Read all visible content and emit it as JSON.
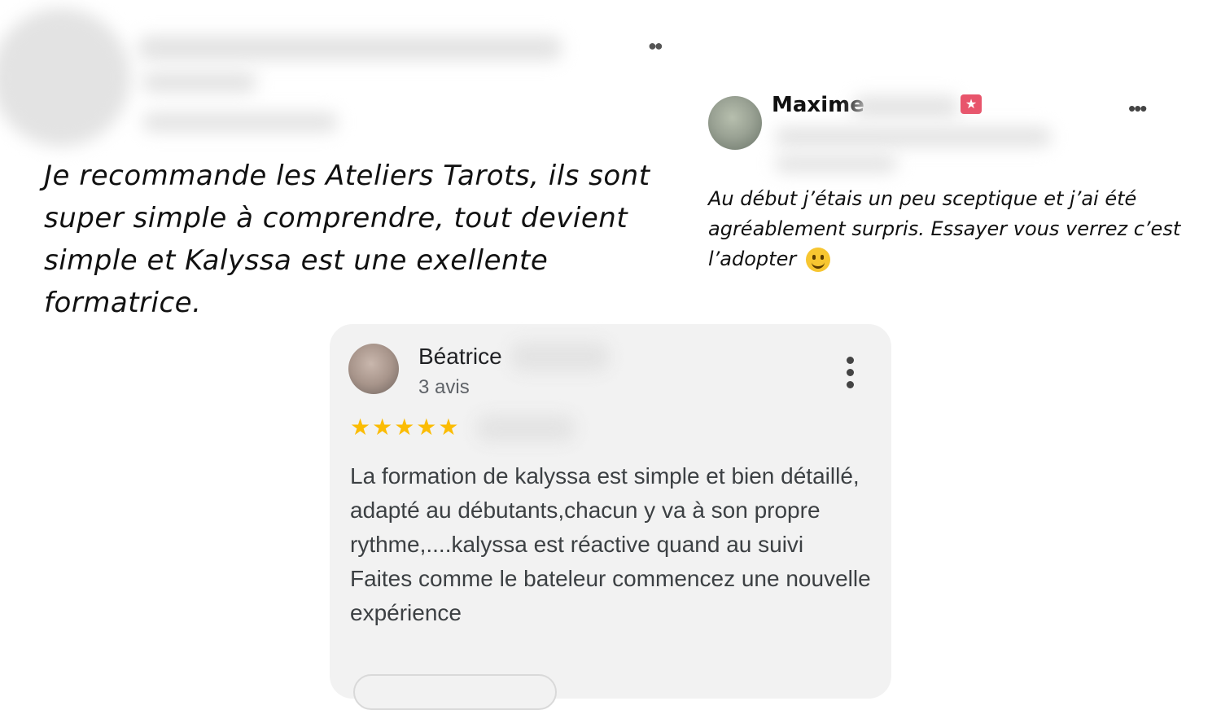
{
  "left_review": {
    "text": "Je recommande les Ateliers Tarots, ils sont super simple à comprendre, tout devient simple et Kalyssa est une exellente formatrice."
  },
  "maxime_review": {
    "name": "Maxime",
    "badge_icon": "star-badge-icon",
    "text": "Au début j’étais un peu sceptique et j’ai été agréablement surpris. Essayer vous verrez c’est l’adopter"
  },
  "beatrice_review": {
    "name": "Béatrice",
    "review_count": "3 avis",
    "rating": 5,
    "stars": "★★★★★",
    "paragraph1": "La formation de kalyssa est simple et bien détaillé, adapté au débutants,chacun y va à son propre rythme,....kalyssa est réactive quand au suivi",
    "paragraph2": "Faites comme le bateleur commencez une nouvelle expérience"
  },
  "colors": {
    "star": "#fbbc04",
    "badge": "#e8546b",
    "card_background": "#f2f2f2"
  }
}
